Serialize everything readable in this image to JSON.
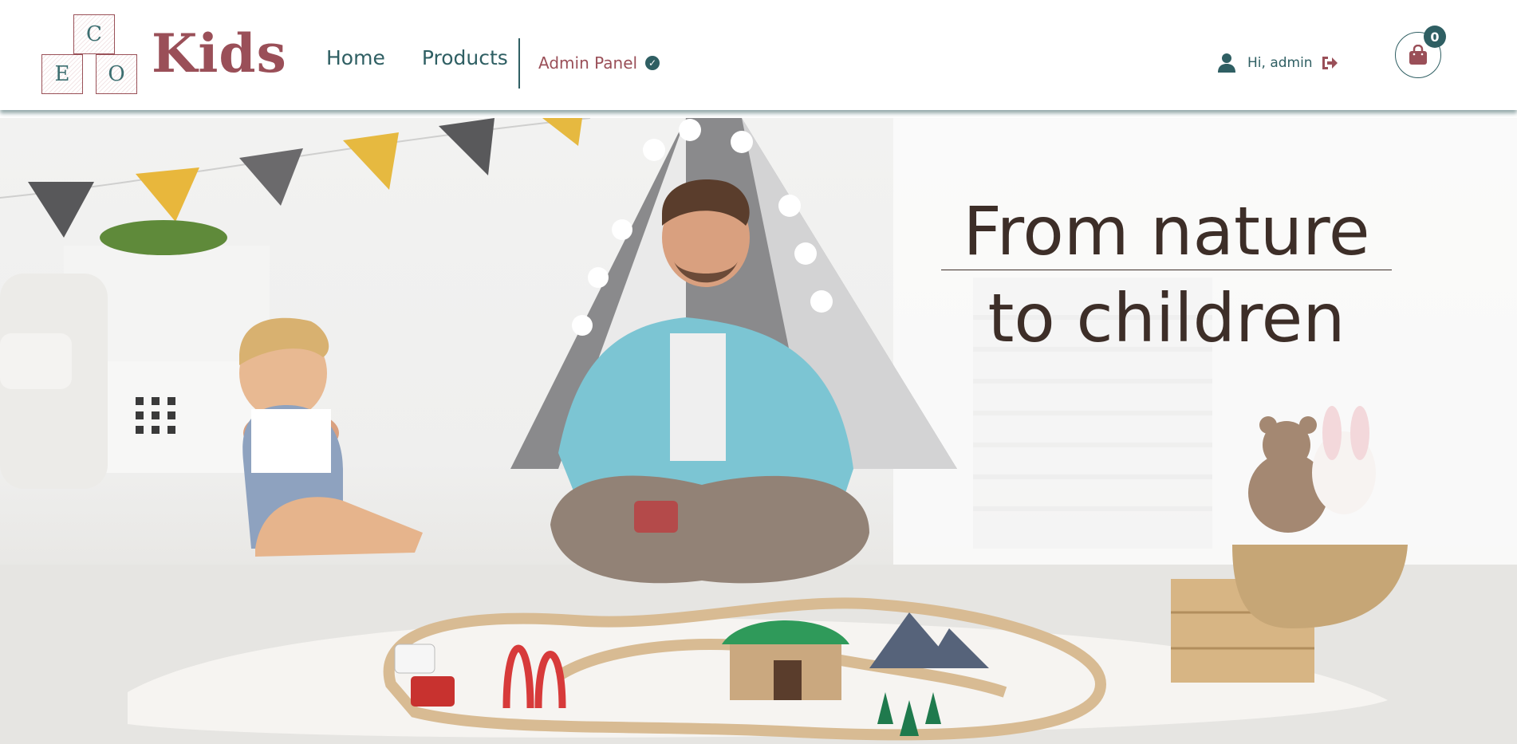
{
  "brand": {
    "block_letters": [
      "C",
      "E",
      "O"
    ],
    "wordmark": "Kids",
    "colors": {
      "rose": "#9a4f58",
      "teal": "#2f5f63"
    }
  },
  "nav": {
    "items": [
      {
        "label": "Home"
      },
      {
        "label": "Products"
      }
    ],
    "admin_label": "Admin Panel",
    "admin_icon": "check-circle-icon"
  },
  "user": {
    "greeting": "Hi, admin",
    "icons": {
      "user": "user-icon",
      "logout": "logout-icon"
    }
  },
  "cart": {
    "count": "0",
    "icon": "shopping-bag-icon"
  },
  "hero": {
    "line1": "From nature",
    "line2": "to children"
  }
}
